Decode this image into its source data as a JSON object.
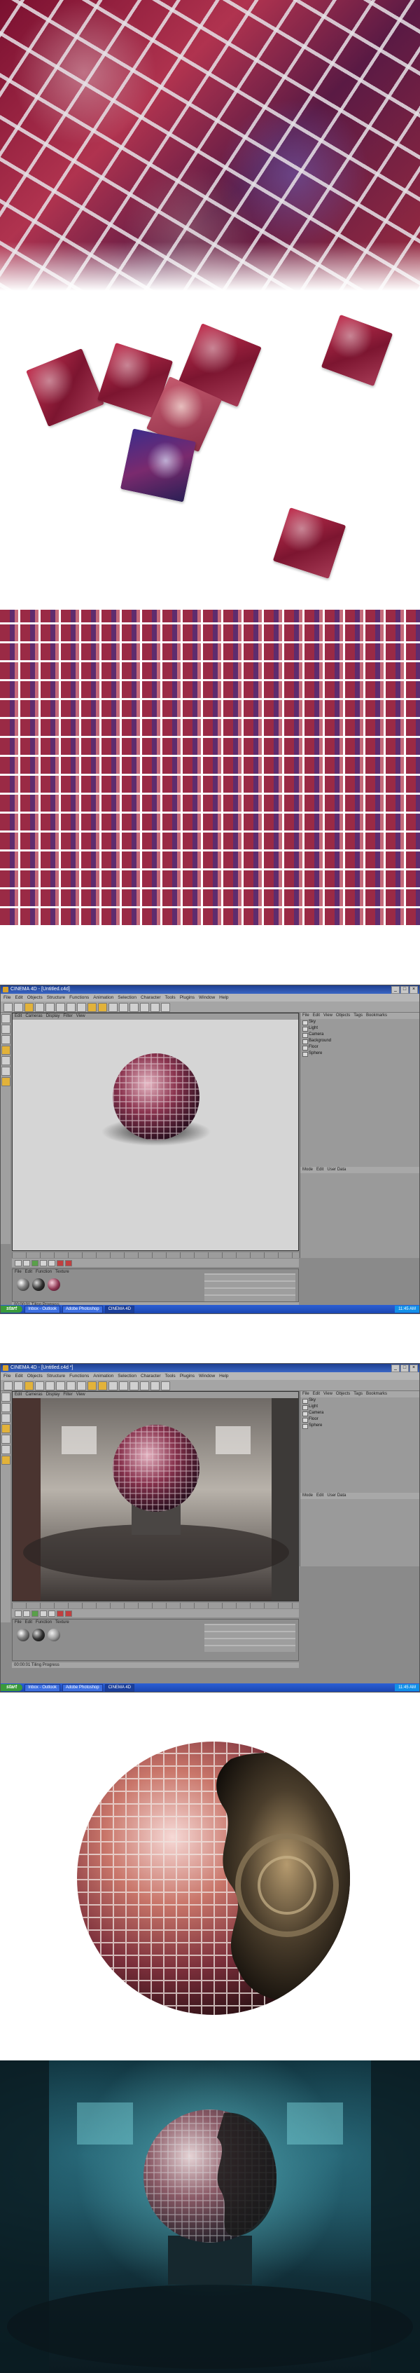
{
  "app": {
    "window_title_1": "CINEMA 4D - [Untitled.c4d]",
    "window_title_2": "CINEMA 4D - [Untitled.c4d *]",
    "menu": [
      "File",
      "Edit",
      "Objects",
      "Structure",
      "Functions",
      "Animation",
      "Selection",
      "Character",
      "Tools",
      "Plugins",
      "Window",
      "Help"
    ],
    "viewport_menu": [
      "Edit",
      "Cameras",
      "Display",
      "Filter",
      "View"
    ],
    "object_panel_menu": [
      "File",
      "Edit",
      "View",
      "Objects",
      "Tags",
      "Bookmarks"
    ],
    "objects_1": [
      "Sky",
      "Light",
      "Camera",
      "Background",
      "Floor",
      "Sphere"
    ],
    "objects_2": [
      "Sky",
      "Light",
      "Camera",
      "Floor",
      "Sphere"
    ],
    "attribute_menu": [
      "Mode",
      "Edit",
      "User Data"
    ],
    "material_menu": [
      "File",
      "Edit",
      "Function",
      "Texture"
    ],
    "status_text": "00:00:01 Tiling Progress",
    "window_buttons": [
      "_",
      "□",
      "×"
    ]
  },
  "taskbar": {
    "start_label": "start",
    "tasks_1": [
      "Inbox - Outlook",
      "Adobe Photoshop",
      "CINEMA 4D"
    ],
    "tasks_2": [
      "Inbox - Outlook",
      "Adobe Photoshop",
      "CINEMA 4D"
    ],
    "clock": "11:45 AM"
  },
  "colors": {
    "mosaic_red": "#9c2b40",
    "mosaic_blue": "#3d2c8a",
    "app_grey": "#8a8a8a",
    "titlebar_blue": "#1e3f8f",
    "final_teal": "#163f4c"
  }
}
